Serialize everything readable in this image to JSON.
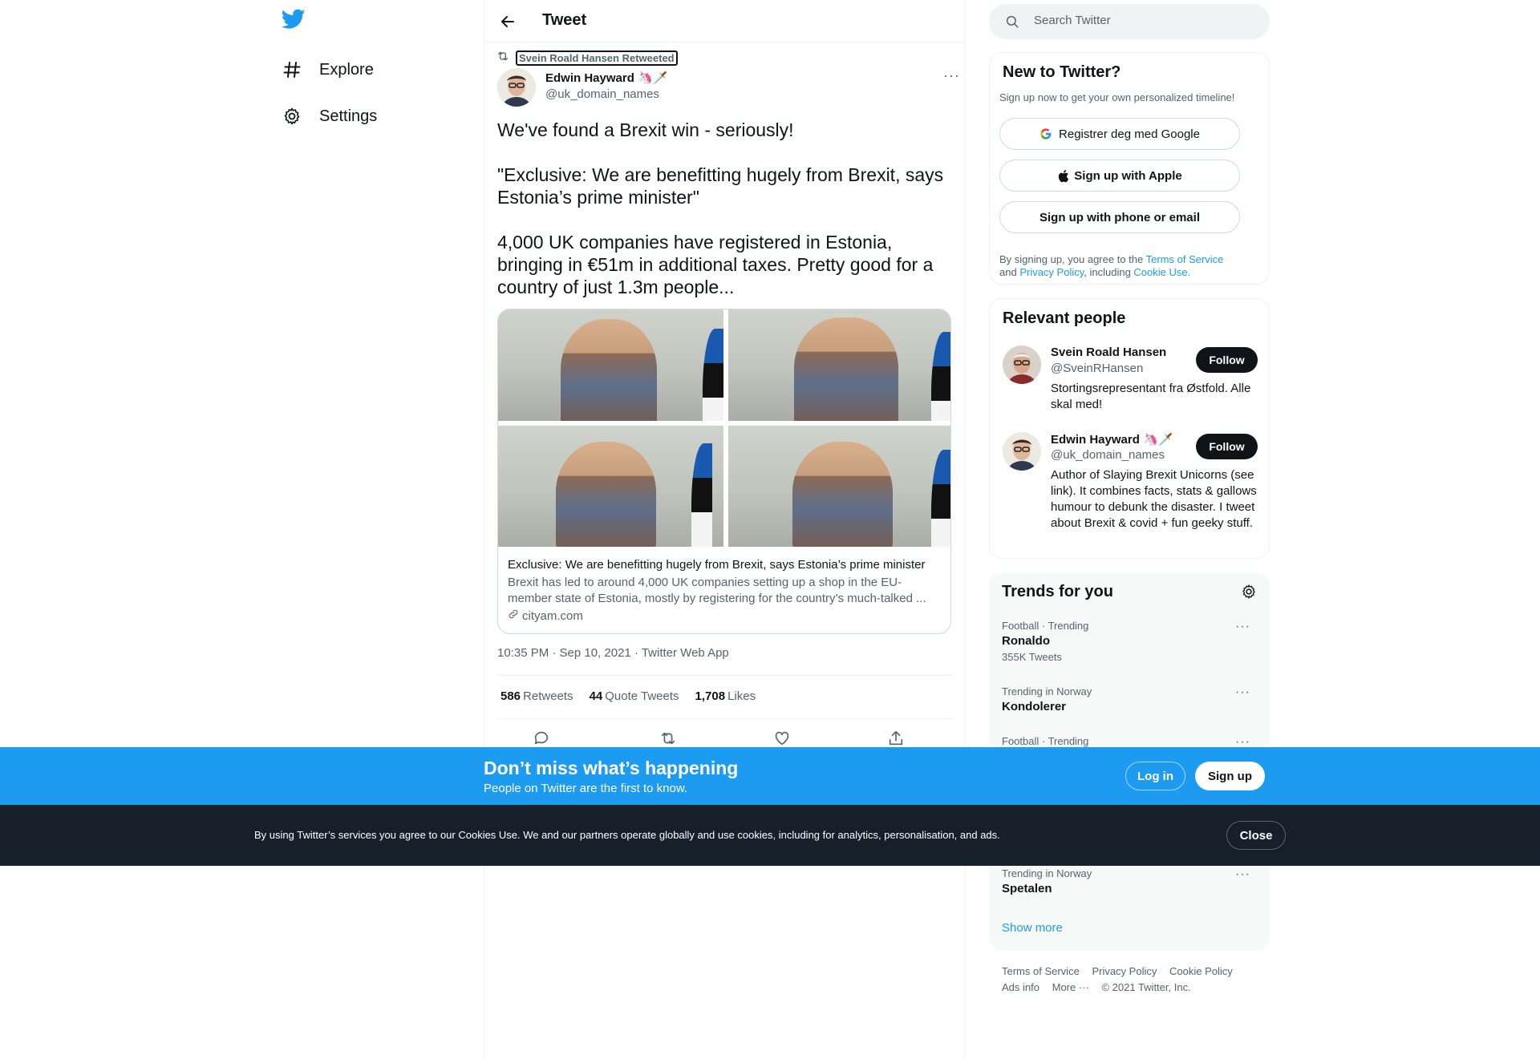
{
  "nav": {
    "items": [
      {
        "label": "Explore",
        "icon": "hashtag-icon"
      },
      {
        "label": "Settings",
        "icon": "gear-icon"
      }
    ]
  },
  "header": {
    "title": "Tweet"
  },
  "tweet": {
    "retweeted_by": "Svein Roald Hansen Retweeted",
    "author_name": "Edwin Hayward 🦄🗡️",
    "author_handle": "@uk_domain_names",
    "text": [
      "We've found a Brexit win - seriously!",
      "\"Exclusive: We are benefitting hugely from Brexit, says Estonia’s prime minister\"",
      "4,000 UK companies have registered in Estonia, bringing in €51m in additional taxes. Pretty good for a country of just 1.3m people..."
    ],
    "card": {
      "title": "Exclusive: We are benefitting hugely from Brexit, says Estonia’s prime minister",
      "description": "Brexit has led to around 4,000 UK companies setting up a shop in the EU-member state of Estonia, mostly by registering for the country’s much-talked ...",
      "domain": "cityam.com"
    },
    "meta": "10:35 PM · Sep 10, 2021 · Twitter Web App",
    "stats": {
      "retweets_count": "586",
      "retweets_label": "Retweets",
      "quotes_count": "44",
      "quotes_label": "Quote Tweets",
      "likes_count": "1,708",
      "likes_label": "Likes"
    }
  },
  "search": {
    "placeholder": "Search Twitter"
  },
  "new_to_twitter": {
    "title": "New to Twitter?",
    "subtitle": "Sign up now to get your own personalized timeline!",
    "google_label": "Registrer deg med Google",
    "apple_label": "Sign up with Apple",
    "phone_label": "Sign up with phone or email",
    "legal_prefix": "By signing up, you agree to the ",
    "terms_link": "Terms of Service",
    "legal_and": " and ",
    "privacy_link": "Privacy Policy",
    "legal_including": ", including ",
    "cookie_link": "Cookie Use."
  },
  "relevant_people": {
    "title": "Relevant people",
    "people": [
      {
        "name": "Svein Roald Hansen",
        "handle": "@SveinRHansen",
        "bio": "Stortingsrepresentant fra Østfold. Alle skal med!",
        "follow": "Follow"
      },
      {
        "name": "Edwin Hayward 🦄🗡️",
        "handle": "@uk_domain_names",
        "bio": "Author of Slaying Brexit Unicorns (see link). It combines facts, stats & gallows humour to debunk the disaster. I tweet about Brexit & covid + fun geeky stuff.",
        "follow": "Follow"
      }
    ]
  },
  "trends": {
    "title": "Trends for you",
    "items": [
      {
        "meta": "Football · Trending",
        "name": "Ronaldo",
        "count": "355K Tweets"
      },
      {
        "meta": "Trending in Norway",
        "name": "Kondolerer",
        "count": ""
      },
      {
        "meta": "Football · Trending",
        "name": "",
        "count": ""
      },
      {
        "meta": "Trending in Norway",
        "name": "Spetalen",
        "count": ""
      }
    ],
    "show_more": "Show more"
  },
  "footer": {
    "terms": "Terms of Service",
    "privacy": "Privacy Policy",
    "cookie": "Cookie Policy",
    "ads": "Ads info",
    "more": "More ···",
    "copyright": "© 2021 Twitter, Inc."
  },
  "bottom_bar": {
    "title": "Don’t miss what’s happening",
    "subtitle": "People on Twitter are the first to know.",
    "login": "Log in",
    "signup": "Sign up"
  },
  "cookie_bar": {
    "text": "By using Twitter’s services you agree to our Cookies Use. We and our partners operate globally and use cookies, including for analytics, personalisation, and ads.",
    "close": "Close"
  },
  "colors": {
    "accent": "#1d9bf0",
    "text": "#0f1419",
    "muted": "#536471",
    "cookie_bg": "#15202b"
  }
}
